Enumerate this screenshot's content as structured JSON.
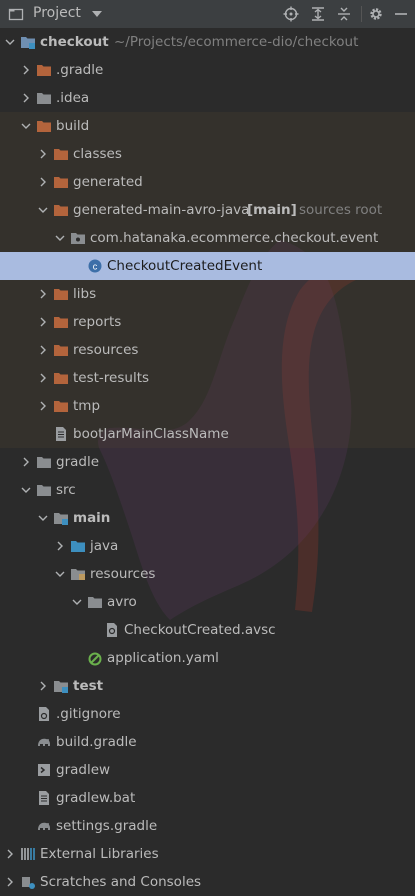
{
  "toolbar": {
    "title": "Project",
    "buttons": [
      "locate-icon",
      "expand-all-icon",
      "collapse-all-icon",
      "gear-icon",
      "hide-icon"
    ]
  },
  "colors": {
    "background": "#2b2b2b",
    "selection": "#a9bbe0",
    "folder": "#b3643c",
    "folder_source": "#3d8fbf",
    "module": "#6f8fb2",
    "watermark": "#c0392b"
  },
  "tree": {
    "checkout": {
      "label": "checkout",
      "path": "~/Projects/ecommerce-dio/checkout"
    },
    "gradle_dir": ".gradle",
    "idea_dir": ".idea",
    "build": "build",
    "classes": "classes",
    "generated": "generated",
    "avro_gen": {
      "label": "generated-main-avro-java",
      "tag": "[main]",
      "note": "sources root"
    },
    "pkg": "com.hatanaka.ecommerce.checkout.event",
    "event_class": "CheckoutCreatedEvent",
    "libs": "libs",
    "reports": "reports",
    "resources_build": "resources",
    "test_results": "test-results",
    "tmp": "tmp",
    "bootjar": "bootJarMainClassName",
    "gradle_folder": "gradle",
    "src": "src",
    "main": "main",
    "java": "java",
    "resources_main": "resources",
    "avro": "avro",
    "avsc": "CheckoutCreated.avsc",
    "app_yaml": "application.yaml",
    "test": "test",
    "gitignore": ".gitignore",
    "build_gradle": "build.gradle",
    "gradlew": "gradlew",
    "gradlew_bat": "gradlew.bat",
    "settings_gradle": "settings.gradle",
    "external_libraries": "External Libraries",
    "scratches": "Scratches and Consoles"
  }
}
